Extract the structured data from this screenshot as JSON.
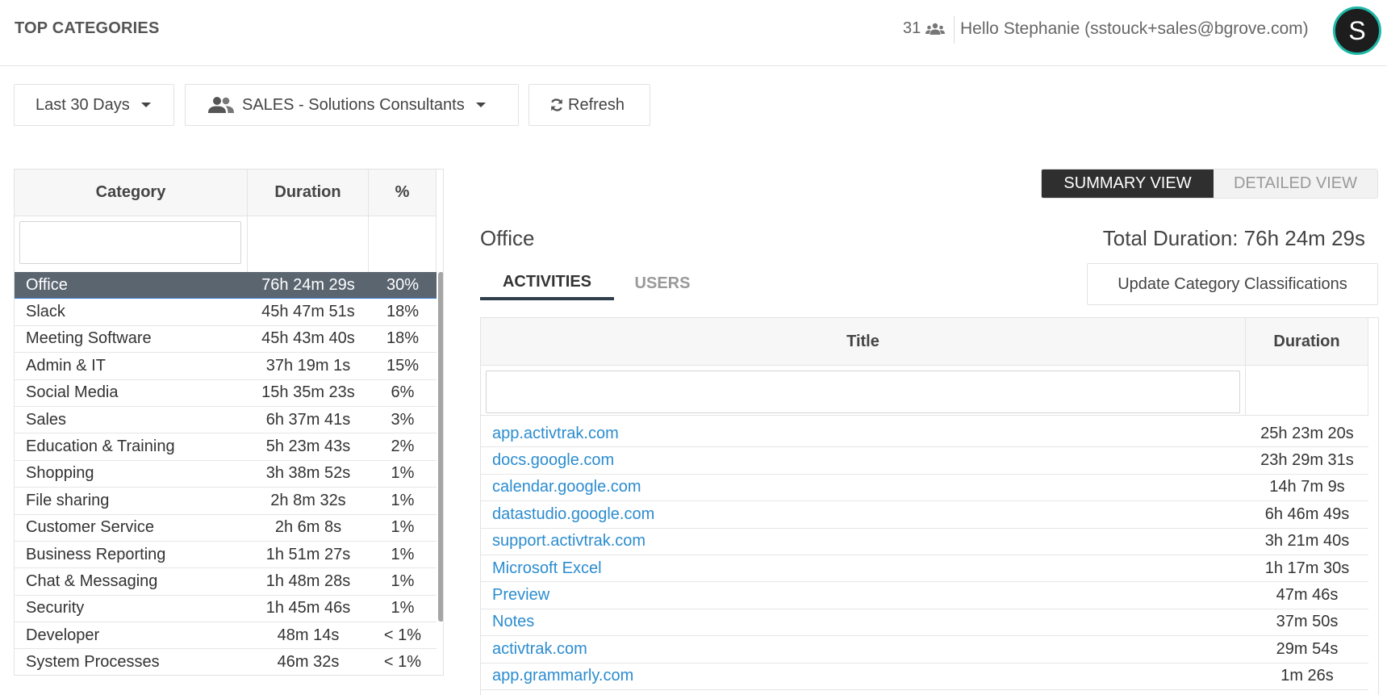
{
  "header": {
    "title": "TOP CATEGORIES",
    "user_count": "31",
    "greeting": "Hello Stephanie (sstouck+sales@bgrove.com)",
    "avatar_initial": "S"
  },
  "toolbar": {
    "date_range": "Last 30 Days",
    "group": "SALES - Solutions Consultants",
    "refresh": "Refresh"
  },
  "categories_table": {
    "headers": [
      "Category",
      "Duration",
      "%"
    ],
    "filter_value": "",
    "selected_index": 0,
    "rows": [
      {
        "category": "Office",
        "duration": "76h 24m 29s",
        "pct": "30%"
      },
      {
        "category": "Slack",
        "duration": "45h 47m 51s",
        "pct": "18%"
      },
      {
        "category": "Meeting Software",
        "duration": "45h 43m 40s",
        "pct": "18%"
      },
      {
        "category": "Admin & IT",
        "duration": "37h 19m 1s",
        "pct": "15%"
      },
      {
        "category": "Social Media",
        "duration": "15h 35m 23s",
        "pct": "6%"
      },
      {
        "category": "Sales",
        "duration": "6h 37m 41s",
        "pct": "3%"
      },
      {
        "category": "Education & Training",
        "duration": "5h 23m 43s",
        "pct": "2%"
      },
      {
        "category": "Shopping",
        "duration": "3h 38m 52s",
        "pct": "1%"
      },
      {
        "category": "File sharing",
        "duration": "2h 8m 32s",
        "pct": "1%"
      },
      {
        "category": "Customer Service",
        "duration": "2h 6m 8s",
        "pct": "1%"
      },
      {
        "category": "Business Reporting",
        "duration": "1h 51m 27s",
        "pct": "1%"
      },
      {
        "category": "Chat & Messaging",
        "duration": "1h 48m 28s",
        "pct": "1%"
      },
      {
        "category": "Security",
        "duration": "1h 45m 46s",
        "pct": "1%"
      },
      {
        "category": "Developer",
        "duration": "48m 14s",
        "pct": "< 1%"
      },
      {
        "category": "System Processes",
        "duration": "46m 32s",
        "pct": "< 1%"
      }
    ]
  },
  "view_toggle": {
    "summary": "SUMMARY VIEW",
    "detailed": "DETAILED VIEW",
    "active": "summary"
  },
  "detail": {
    "category_title": "Office",
    "total_duration": "Total Duration: 76h 24m 29s",
    "tabs": [
      "ACTIVITIES",
      "USERS"
    ],
    "active_tab": "ACTIVITIES",
    "update_button": "Update Category Classifications",
    "table_headers": [
      "Title",
      "Duration"
    ],
    "filter_value": "",
    "rows": [
      {
        "title": "app.activtrak.com",
        "duration": "25h 23m 20s"
      },
      {
        "title": "docs.google.com",
        "duration": "23h 29m 31s"
      },
      {
        "title": "calendar.google.com",
        "duration": "14h 7m 9s"
      },
      {
        "title": "datastudio.google.com",
        "duration": "6h 46m 49s"
      },
      {
        "title": "support.activtrak.com",
        "duration": "3h 21m 40s"
      },
      {
        "title": "Microsoft Excel",
        "duration": "1h 17m 30s"
      },
      {
        "title": "Preview",
        "duration": "47m 46s"
      },
      {
        "title": "Notes",
        "duration": "37m 50s"
      },
      {
        "title": "activtrak.com",
        "duration": "29m 54s"
      },
      {
        "title": "app.grammarly.com",
        "duration": "1m 26s"
      }
    ]
  },
  "colors": {
    "selected_row": "#5b6570",
    "link": "#2b8ccf",
    "avatar_ring": "#1fb9a7",
    "toggle_active": "#2f2f2f"
  },
  "icons": {
    "user_count": "users-icon",
    "group": "group-icon",
    "refresh": "refresh-icon",
    "caret": "caret-down-icon"
  }
}
